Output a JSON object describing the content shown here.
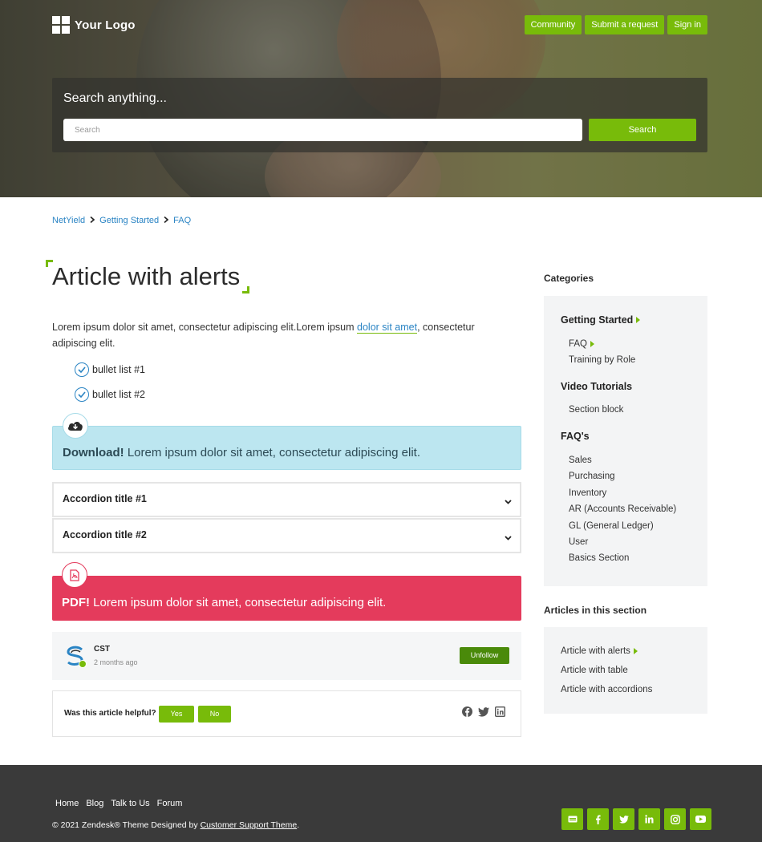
{
  "header": {
    "logo_text": "Your Logo",
    "nav": [
      "Community",
      "Submit a request",
      "Sign in"
    ]
  },
  "search": {
    "title": "Search anything...",
    "placeholder": "Search",
    "button": "Search"
  },
  "breadcrumb": [
    "NetYield",
    "Getting Started",
    "FAQ"
  ],
  "article": {
    "title": "Article with alerts",
    "body_part1": "Lorem ipsum dolor sit amet, consectetur adipiscing elit.Lorem ipsum ",
    "body_link": "dolor sit amet",
    "body_part2": ", consectetur adipiscing elit.",
    "bullets": [
      "bullet list #1",
      "bullet list #2"
    ],
    "download_alert": {
      "lead": "Download!",
      "text": " Lorem ipsum dolor sit amet, consectetur adipiscing elit.",
      "icon": "cloud-download-icon",
      "color": "#bce6f0"
    },
    "accordions": [
      "Accordion title #1",
      "Accordion title #2"
    ],
    "pdf_alert": {
      "lead": "PDF!",
      "text": " Lorem ipsum dolor sit amet, consectetur adipiscing elit.",
      "icon": "pdf-file-icon",
      "color": "#e43b5c"
    },
    "author": {
      "name": "CST",
      "time": "2 months ago",
      "follow_button": "Unfollow"
    },
    "vote": {
      "question": "Was this article helpful?",
      "yes": "Yes",
      "no": "No"
    }
  },
  "sidebar": {
    "categories_heading": "Categories",
    "categories": [
      {
        "title": "Getting Started",
        "active": true,
        "items": [
          {
            "label": "FAQ",
            "active": true
          },
          {
            "label": "Training by Role"
          }
        ]
      },
      {
        "title": "Video Tutorials",
        "items": [
          {
            "label": "Section block"
          }
        ]
      },
      {
        "title": "FAQ's",
        "items": [
          {
            "label": "Sales"
          },
          {
            "label": "Purchasing"
          },
          {
            "label": "Inventory"
          },
          {
            "label": "AR (Accounts Receivable)"
          },
          {
            "label": "GL (General Ledger)"
          },
          {
            "label": "User"
          },
          {
            "label": "Basics Section"
          }
        ]
      }
    ],
    "articles_heading": "Articles in this section",
    "articles": [
      {
        "label": "Article with alerts",
        "active": true
      },
      {
        "label": "Article with table"
      },
      {
        "label": "Article with accordions"
      }
    ]
  },
  "footer": {
    "nav": [
      "Home",
      "Blog",
      "Talk to Us",
      "Forum"
    ],
    "copyright_prefix": "© 2021 Zendesk® Theme Designed by ",
    "copyright_link": "Customer Support Theme",
    "copyright_suffix": ".",
    "socials": [
      "ticket-icon",
      "facebook-icon",
      "twitter-icon",
      "linkedin-icon",
      "instagram-icon",
      "youtube-icon"
    ]
  },
  "colors": {
    "accent": "#78bb0a",
    "link": "#2a84c4",
    "footer_bg": "#3a3a3a"
  }
}
